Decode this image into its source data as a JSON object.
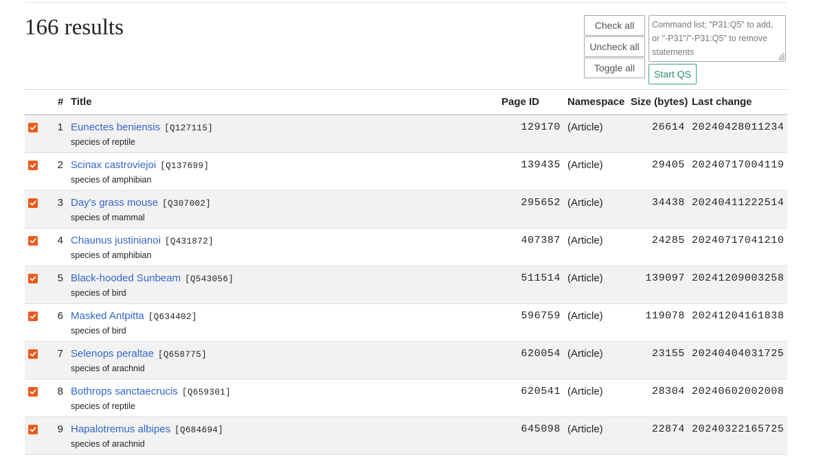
{
  "header": {
    "results_title": "166 results"
  },
  "controls": {
    "check_all": "Check all",
    "uncheck_all": "Uncheck all",
    "toggle_all": "Toggle all",
    "command_placeholder": "Command list; \"P31:Q5\" to add, or \"-P31\"/\"-P31:Q5\" to remove statements",
    "start_qs": "Start QS"
  },
  "colors": {
    "checkbox": "#ea5a1a",
    "link": "#3366cc",
    "qs_button": "#36a38a"
  },
  "table": {
    "columns": [
      "#",
      "Title",
      "Page ID",
      "Namespace",
      "Size (bytes)",
      "Last change"
    ],
    "rows": [
      {
        "checked": true,
        "num": "1",
        "title": "Eunectes beniensis",
        "qid": "[Q127115]",
        "desc": "species of reptile",
        "page_id": "129170",
        "namespace": "(Article)",
        "size": "26614",
        "last_change": "20240428011234"
      },
      {
        "checked": true,
        "num": "2",
        "title": "Scinax castroviejoi",
        "qid": "[Q137699]",
        "desc": "species of amphibian",
        "page_id": "139435",
        "namespace": "(Article)",
        "size": "29405",
        "last_change": "20240717004119"
      },
      {
        "checked": true,
        "num": "3",
        "title": "Day's grass mouse",
        "qid": "[Q307002]",
        "desc": "species of mammal",
        "page_id": "295652",
        "namespace": "(Article)",
        "size": "34438",
        "last_change": "20240411222514"
      },
      {
        "checked": true,
        "num": "4",
        "title": "Chaunus justinianoi",
        "qid": "[Q431872]",
        "desc": "species of amphibian",
        "page_id": "407387",
        "namespace": "(Article)",
        "size": "24285",
        "last_change": "20240717041210"
      },
      {
        "checked": true,
        "num": "5",
        "title": "Black-hooded Sunbeam",
        "qid": "[Q543056]",
        "desc": "species of bird",
        "page_id": "511514",
        "namespace": "(Article)",
        "size": "139097",
        "last_change": "20241209003258"
      },
      {
        "checked": true,
        "num": "6",
        "title": "Masked Antpitta",
        "qid": "[Q634402]",
        "desc": "species of bird",
        "page_id": "596759",
        "namespace": "(Article)",
        "size": "119078",
        "last_change": "20241204161838"
      },
      {
        "checked": true,
        "num": "7",
        "title": "Selenops peraltae",
        "qid": "[Q658775]",
        "desc": "species of arachnid",
        "page_id": "620054",
        "namespace": "(Article)",
        "size": "23155",
        "last_change": "20240404031725"
      },
      {
        "checked": true,
        "num": "8",
        "title": "Bothrops sanctaecrucis",
        "qid": "[Q659301]",
        "desc": "species of reptile",
        "page_id": "620541",
        "namespace": "(Article)",
        "size": "28304",
        "last_change": "20240602002008"
      },
      {
        "checked": true,
        "num": "9",
        "title": "Hapalotremus albipes",
        "qid": "[Q684694]",
        "desc": "species of arachnid",
        "page_id": "645098",
        "namespace": "(Article)",
        "size": "22874",
        "last_change": "20240322165725"
      }
    ]
  }
}
